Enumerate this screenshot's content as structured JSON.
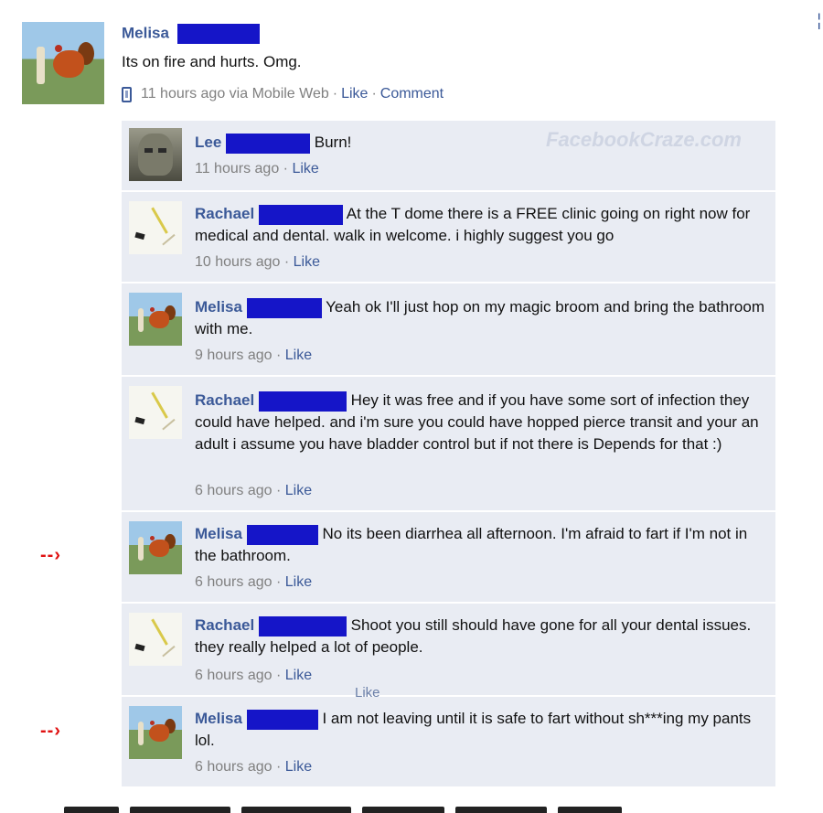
{
  "post": {
    "author": "Melisa",
    "text": "Its on fire and hurts. Omg.",
    "time": "11 hours ago via Mobile Web",
    "like_label": "Like",
    "comment_label": "Comment",
    "sep": "·",
    "avatar_icon": "rooster-photo-avatar",
    "device_icon": "mobile-phone-icon"
  },
  "top_right_mark": "¦",
  "watermark": "FacebookCraze.com",
  "comments": [
    {
      "author": "Lee",
      "text": "Burn!",
      "time": "11 hours ago",
      "like": "Like",
      "sep": "·"
    },
    {
      "author": "Rachael",
      "text": "At the T dome there is a FREE clinic going on right now for medical and dental. walk in welcome. i highly suggest you go",
      "time": "10 hours ago",
      "like": "Like",
      "sep": "·"
    },
    {
      "author": "Melisa",
      "text": "Yeah ok I'll just hop on my magic broom and bring the bathroom with me.",
      "time": "9 hours ago",
      "like": "Like",
      "sep": "·"
    },
    {
      "author": "Rachael",
      "text": "Hey it was free and if you have some sort of infection they could have helped. and i'm sure you could have hopped pierce transit and your an adult i assume you have bladder control but if not there is Depends for that :)",
      "time": "6 hours ago",
      "like": "Like",
      "sep": "·"
    },
    {
      "author": "Melisa",
      "text": "No its been diarrhea all afternoon. I'm afraid to fart if I'm not in the bathroom.",
      "time": "6 hours ago",
      "like": "Like",
      "sep": "·"
    },
    {
      "author": "Rachael",
      "text": "Shoot you still should have gone for all your dental issues. they really helped a lot of people.",
      "time": "6 hours ago",
      "like": "Like",
      "sep": "·"
    },
    {
      "author": "Melisa",
      "text": "I am not leaving until it is safe to fart without sh***ing my pants lol.",
      "time": "6 hours ago",
      "like": "Like",
      "sep": "·"
    }
  ],
  "floating_like": "Like",
  "arrow_label": "--›",
  "colors": {
    "link": "#3b5998",
    "redaction": "#1515c8",
    "comment_bg": "#e9ecf3",
    "arrow": "#e01010",
    "meta_grey": "#808080"
  }
}
